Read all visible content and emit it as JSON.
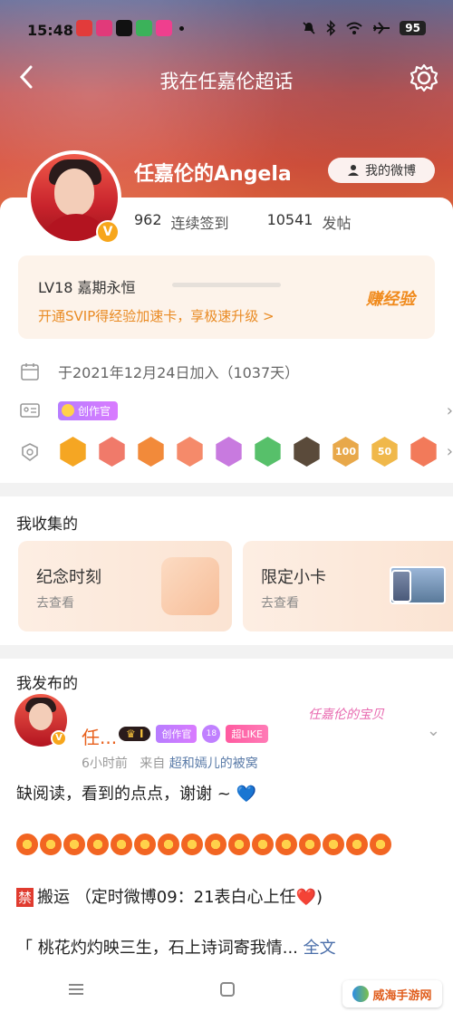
{
  "status_bar": {
    "time": "15:48",
    "battery": "95",
    "apps": [
      "#e23b3b",
      "#e13a7a",
      "#111111",
      "#3bb25a",
      "#ef3f8e"
    ]
  },
  "nav": {
    "title": "我在任嘉伦超话"
  },
  "profile": {
    "name": "任嘉伦的Angela",
    "my_weibo": "我的微博",
    "checkin_count": "962",
    "checkin_label": "连续签到",
    "post_count": "10541",
    "post_label": "发帖",
    "level": "LV18 嘉期永恒",
    "level_progress": 0.0,
    "promo": "开通SVIP得经验加速卡，享极速升级 >",
    "earn": "赚经验",
    "joined": "于2021年12月24日加入（1037天）",
    "creator_badge": "创作官"
  },
  "medals": {
    "colors": [
      "#f5a623",
      "#f07a6a",
      "#f28a3a",
      "#f58a6a",
      "#c87adf",
      "#57c06a",
      "#5a4a3a",
      "#e8a84a",
      "#f0b84a",
      "#f27a5a"
    ],
    "labels": [
      "",
      "",
      "",
      "",
      "",
      "",
      "",
      "100",
      "50",
      ""
    ]
  },
  "collections": {
    "title": "我收集的",
    "items": [
      {
        "title": "纪念时刻",
        "subtitle": "去查看"
      },
      {
        "title": "限定小卡",
        "subtitle": "去查看"
      }
    ]
  },
  "posts": {
    "title": "我发布的",
    "author": "任...",
    "crown_level": "I",
    "creator_badge": "创作官",
    "gem_level": "18",
    "super_like": "超LIKE",
    "time": "6小时前",
    "from_prefix": "来自",
    "source": "超和嫣儿的被窝",
    "signature": "任嘉伦的宝贝",
    "line1": "缺阅读，看到的点点，谢谢 ~ 💙",
    "flower_count": 16,
    "ban_char": "禁",
    "line3": "搬运 （定时微博09：21表白心上任❤️)",
    "line4": "「 桃花灼灼映三生，石上诗词寄我情...",
    "more": "全文"
  },
  "watermark": "威海手游网",
  "icons": {
    "back": "back-arrow-icon",
    "settings": "gear-icon",
    "user": "user-icon",
    "calendar": "calendar-icon",
    "id_card": "id-card-icon",
    "medal": "medal-icon"
  }
}
